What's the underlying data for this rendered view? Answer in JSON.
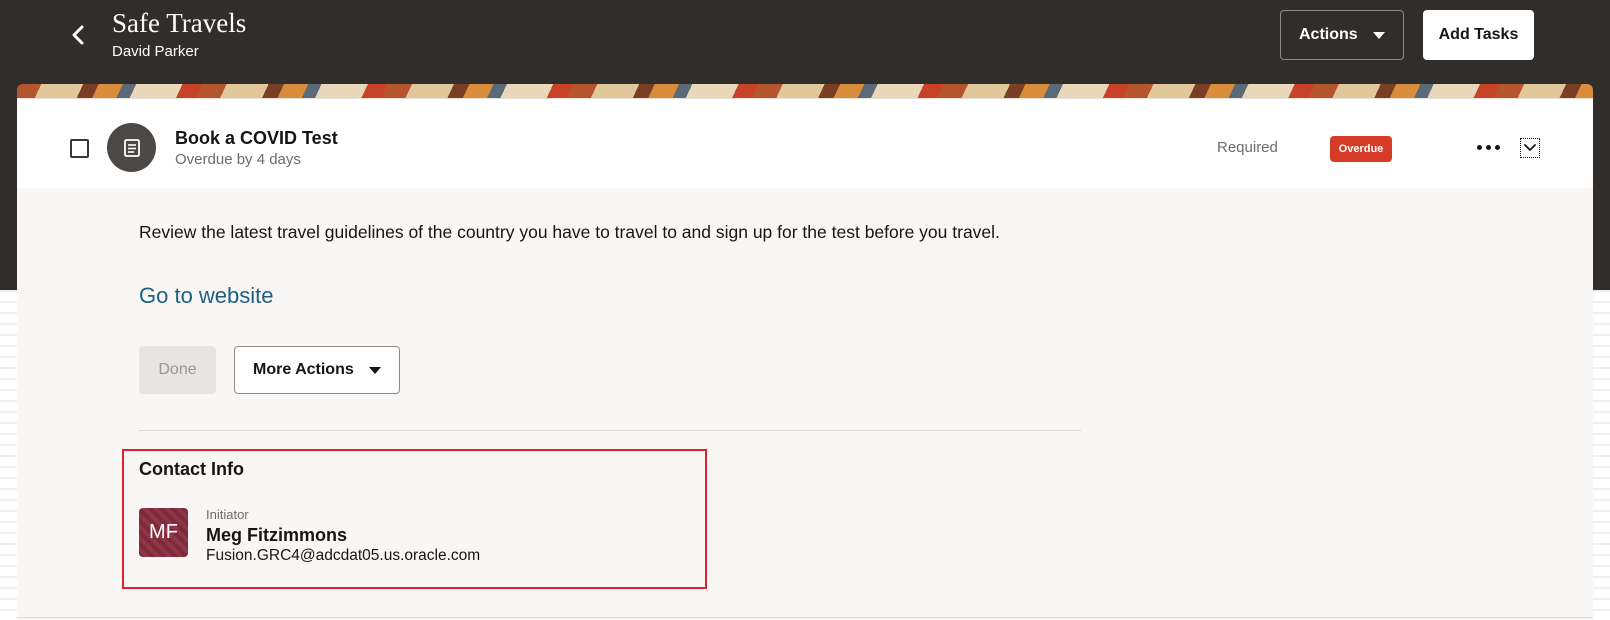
{
  "header": {
    "title": "Safe Travels",
    "subtitle": "David Parker",
    "actions_label": "Actions",
    "add_tasks_label": "Add Tasks"
  },
  "task": {
    "title": "Book a COVID Test",
    "status_text": "Overdue by 4 days",
    "required_label": "Required",
    "badge_label": "Overdue",
    "description": "Review the latest travel guidelines of the country you have to travel to and sign up for the test before you travel.",
    "link_label": "Go to website",
    "done_label": "Done",
    "more_actions_label": "More Actions"
  },
  "contact": {
    "heading": "Contact Info",
    "initials": "MF",
    "role": "Initiator",
    "name": "Meg Fitzimmons",
    "email": "Fusion.GRC4@adcdat05.us.oracle.com"
  },
  "colors": {
    "header_bg": "#312d2a",
    "overdue_badge": "#d63b25",
    "link": "#1f5f7f",
    "highlight_border": "#e0212b",
    "avatar_bg": "#7e2a3a"
  },
  "icons": {
    "back": "chevron-left-icon",
    "actions_caret": "caret-down-icon",
    "task": "document-icon",
    "more": "more-horizontal-icon",
    "expand": "chevron-down-icon"
  }
}
